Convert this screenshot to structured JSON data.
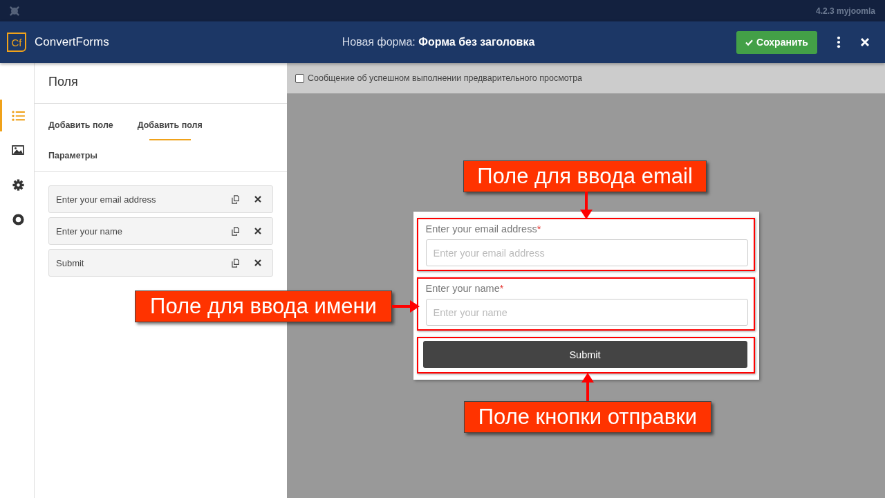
{
  "topbar": {
    "version": "4.2.3 myjoomla"
  },
  "header": {
    "logo_mark": "Cf",
    "brand": "ConvertForms",
    "title_prefix": "Новая форма:",
    "title": "Форма без заголовка",
    "save_label": "Сохранить"
  },
  "rail": [
    {
      "kind": "list",
      "selected": true
    },
    {
      "kind": "image",
      "selected": false
    },
    {
      "kind": "gear",
      "selected": false
    },
    {
      "kind": "circle",
      "selected": false
    }
  ],
  "panel": {
    "title": "Поля",
    "tabs": [
      {
        "label": "Добавить поле",
        "selected": false
      },
      {
        "label": "Добавить поля",
        "selected": true
      },
      {
        "label": "Параметры",
        "selected": false
      }
    ],
    "field_items": [
      {
        "label": "Enter your email address"
      },
      {
        "label": "Enter your name"
      },
      {
        "label": "Submit"
      }
    ]
  },
  "preview": {
    "checkbox": {
      "label": "Сообщение об успешном выполнении предварительного просмотра",
      "checked": false
    },
    "form_fields": [
      {
        "kind": "input",
        "label": "Enter your email address",
        "required_mark": "*",
        "placeholder": "Enter your email address"
      },
      {
        "kind": "input",
        "label": "Enter your name",
        "required_mark": "*",
        "placeholder": "Enter your name"
      },
      {
        "kind": "button",
        "label": "Submit"
      }
    ]
  },
  "annotations": [
    {
      "kind": "above",
      "text": "Поле для ввода email"
    },
    {
      "kind": "beside",
      "text": "Поле для ввода имени"
    },
    {
      "kind": "below",
      "text": "Поле кнопки отправки"
    }
  ]
}
